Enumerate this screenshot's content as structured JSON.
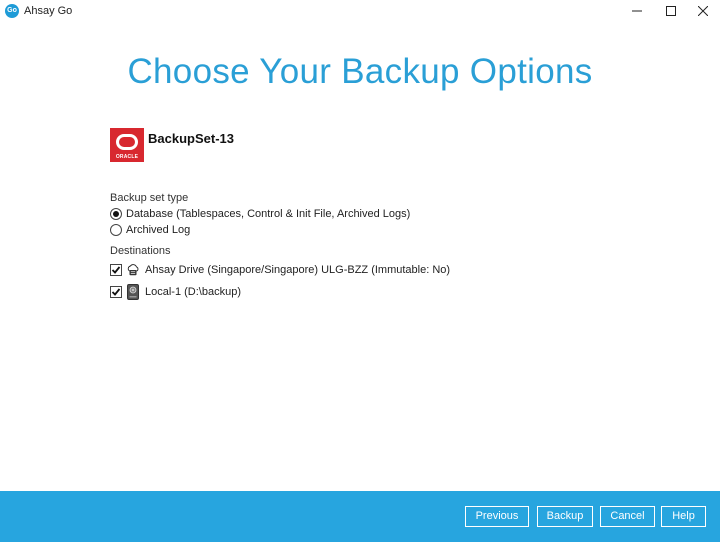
{
  "window": {
    "app_title": "Ahsay Go",
    "logo_text": "Go"
  },
  "page": {
    "title": "Choose Your Backup Options"
  },
  "backupset": {
    "name": "BackupSet-13",
    "logo_icon": "oracle-logo",
    "logo_text": "ORACLE",
    "brand_color": "#d8282f"
  },
  "backup_set_type": {
    "label": "Backup set type",
    "options": [
      {
        "label": "Database (Tablespaces, Control & Init File, Archived Logs)",
        "selected": true
      },
      {
        "label": "Archived Log",
        "selected": false
      }
    ]
  },
  "destinations": {
    "label": "Destinations",
    "items": [
      {
        "label": "Ahsay Drive (Singapore/Singapore) ULG-BZZ (Immutable: No)",
        "checked": true,
        "icon": "cloud-drive-icon"
      },
      {
        "label": "Local-1 (D:\\backup)",
        "checked": true,
        "icon": "local-drive-icon"
      }
    ]
  },
  "footer": {
    "previous_label": "Previous",
    "backup_label": "Backup",
    "cancel_label": "Cancel",
    "help_label": "Help"
  },
  "colors": {
    "accent": "#2a9fd6",
    "footer_bg": "#27a5df"
  }
}
